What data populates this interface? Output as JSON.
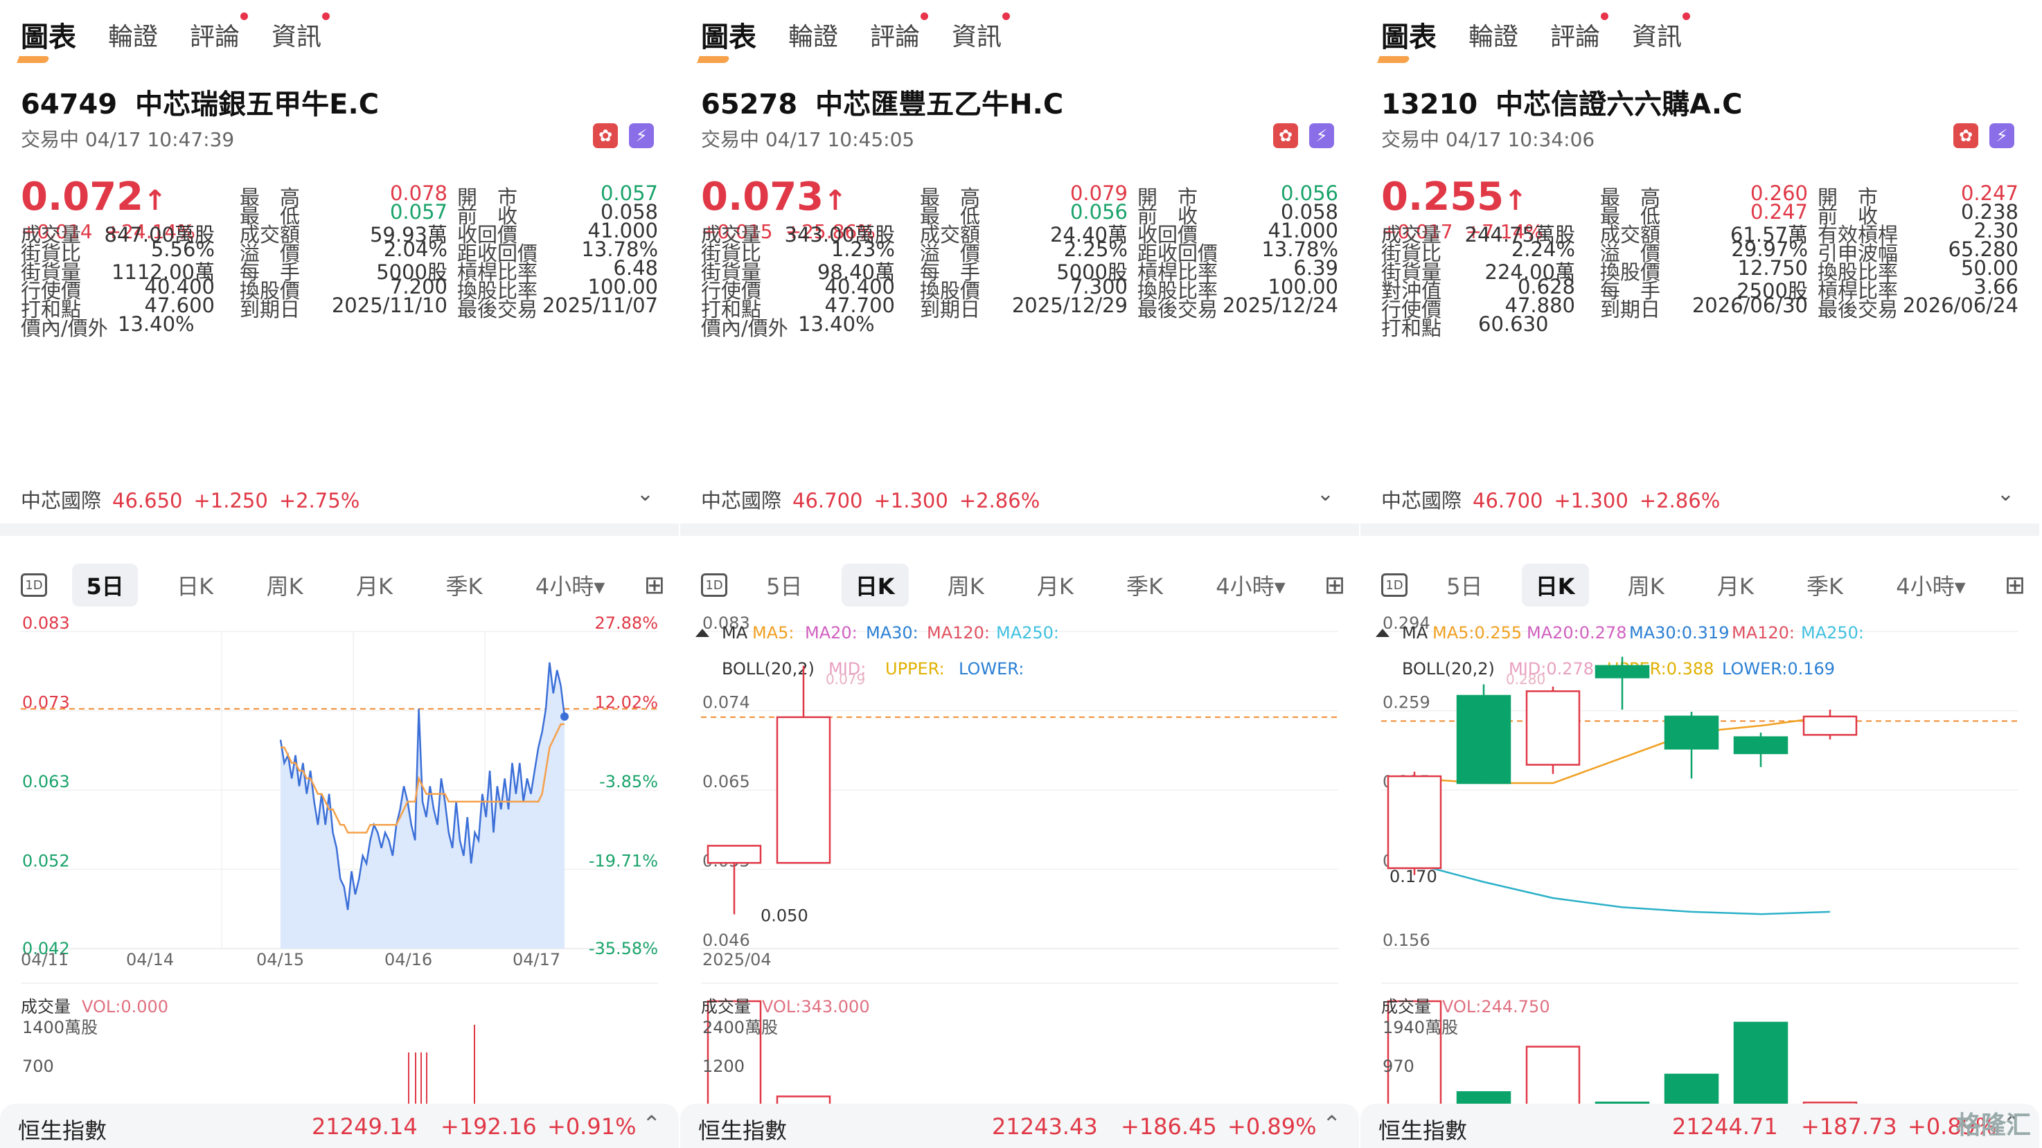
{
  "tabs": [
    {
      "label": "圖表",
      "active": true,
      "dot": false
    },
    {
      "label": "輪證",
      "active": false,
      "dot": false
    },
    {
      "label": "評論",
      "active": false,
      "dot": true
    },
    {
      "label": "資訊",
      "active": false,
      "dot": true
    }
  ],
  "panels": [
    {
      "code": "64749",
      "name": "中芯瑞銀五甲牛E.C",
      "status": "交易中 04/17 10:47:39",
      "price": "0.072",
      "change": "+0.014",
      "change_pct": "+24.14%",
      "quotes": [
        [
          [
            "最　高",
            "0.078",
            "red"
          ],
          [
            "開　市",
            "0.057",
            "green"
          ]
        ],
        [
          [
            "最　低",
            "0.057",
            "green"
          ],
          [
            "前　收",
            "0.058",
            ""
          ]
        ],
        [
          [
            "成交量",
            "847.00萬股",
            ""
          ],
          [
            "成交額",
            "59.93萬",
            ""
          ],
          [
            "收回價",
            "41.000",
            ""
          ]
        ],
        [
          [
            "街貨比",
            "5.56%",
            ""
          ],
          [
            "溢　價",
            "2.04%",
            ""
          ],
          [
            "距收回價",
            "13.78%",
            ""
          ]
        ],
        [
          [
            "街貨量",
            "1112.00萬",
            ""
          ],
          [
            "每　手",
            "5000股",
            ""
          ],
          [
            "槓桿比率",
            "6.48",
            ""
          ]
        ],
        [
          [
            "行使價",
            "40.400",
            ""
          ],
          [
            "換股價",
            "7.200",
            ""
          ],
          [
            "換股比率",
            "100.00",
            ""
          ]
        ],
        [
          [
            "打和點",
            "47.600",
            ""
          ],
          [
            "到期日",
            "2025/11/10",
            ""
          ],
          [
            "最後交易",
            "2025/11/07",
            ""
          ]
        ],
        [
          [
            "價內/價外",
            "13.40%",
            ""
          ]
        ]
      ],
      "underlying": {
        "name": "中芯國際",
        "price": "46.650",
        "change": "+1.250",
        "pct": "+2.75%"
      },
      "ktabs": [
        "5日",
        "日K",
        "周K",
        "月K",
        "季K",
        "4小時▾"
      ],
      "ktab_active": 0,
      "index": {
        "name": "恒生指數",
        "value": "21249.14",
        "change": "+192.16",
        "pct": "+0.91%"
      }
    },
    {
      "code": "65278",
      "name": "中芯匯豐五乙牛H.C",
      "status": "交易中 04/17 10:45:05",
      "price": "0.073",
      "change": "+0.015",
      "change_pct": "+25.86%",
      "quotes": [
        [
          [
            "最　高",
            "0.079",
            "red"
          ],
          [
            "開　市",
            "0.056",
            "green"
          ]
        ],
        [
          [
            "最　低",
            "0.056",
            "green"
          ],
          [
            "前　收",
            "0.058",
            ""
          ]
        ],
        [
          [
            "成交量",
            "343.00萬股",
            ""
          ],
          [
            "成交額",
            "24.40萬",
            ""
          ],
          [
            "收回價",
            "41.000",
            ""
          ]
        ],
        [
          [
            "街貨比",
            "1.23%",
            ""
          ],
          [
            "溢　價",
            "2.25%",
            ""
          ],
          [
            "距收回價",
            "13.78%",
            ""
          ]
        ],
        [
          [
            "街貨量",
            "98.40萬",
            ""
          ],
          [
            "每　手",
            "5000股",
            ""
          ],
          [
            "槓桿比率",
            "6.39",
            ""
          ]
        ],
        [
          [
            "行使價",
            "40.400",
            ""
          ],
          [
            "換股價",
            "7.300",
            ""
          ],
          [
            "換股比率",
            "100.00",
            ""
          ]
        ],
        [
          [
            "打和點",
            "47.700",
            ""
          ],
          [
            "到期日",
            "2025/12/29",
            ""
          ],
          [
            "最後交易",
            "2025/12/24",
            ""
          ]
        ],
        [
          [
            "價內/價外",
            "13.40%",
            ""
          ]
        ]
      ],
      "underlying": {
        "name": "中芯國際",
        "price": "46.700",
        "change": "+1.300",
        "pct": "+2.86%"
      },
      "ktabs": [
        "5日",
        "日K",
        "周K",
        "月K",
        "季K",
        "4小時▾"
      ],
      "ktab_active": 1,
      "index": {
        "name": "恒生指數",
        "value": "21243.43",
        "change": "+186.45",
        "pct": "+0.89%"
      }
    },
    {
      "code": "13210",
      "name": "中芯信證六六購A.C",
      "status": "交易中 04/17 10:34:06",
      "price": "0.255",
      "change": "+0.017",
      "change_pct": "+7.14%",
      "quotes": [
        [
          [
            "最　高",
            "0.260",
            "red"
          ],
          [
            "開　市",
            "0.247",
            "red"
          ]
        ],
        [
          [
            "最　低",
            "0.247",
            "red"
          ],
          [
            "前　收",
            "0.238",
            ""
          ]
        ],
        [
          [
            "成交量",
            "244.75萬股",
            ""
          ],
          [
            "成交額",
            "61.57萬",
            ""
          ],
          [
            "有效槓桿",
            "2.30",
            ""
          ]
        ],
        [
          [
            "街貨比",
            "2.24%",
            ""
          ],
          [
            "溢　價",
            "29.97%",
            ""
          ],
          [
            "引申波幅",
            "65.280",
            ""
          ]
        ],
        [
          [
            "街貨量",
            "224.00萬",
            ""
          ],
          [
            "換股價",
            "12.750",
            ""
          ],
          [
            "換股比率",
            "50.00",
            ""
          ]
        ],
        [
          [
            "對沖值",
            "0.628",
            ""
          ],
          [
            "每　手",
            "2500股",
            ""
          ],
          [
            "槓桿比率",
            "3.66",
            ""
          ]
        ],
        [
          [
            "行使價",
            "47.880",
            ""
          ],
          [
            "到期日",
            "2026/06/30",
            ""
          ],
          [
            "最後交易",
            "2026/06/24",
            ""
          ]
        ],
        [
          [
            "打和點",
            "60.630",
            ""
          ]
        ]
      ],
      "underlying": {
        "name": "中芯國際",
        "price": "46.700",
        "change": "+1.300",
        "pct": "+2.86%"
      },
      "ktabs": [
        "5日",
        "日K",
        "周K",
        "月K",
        "季K",
        "4小時▾"
      ],
      "ktab_active": 1,
      "index": {
        "name": "恒生指數",
        "value": "21244.71",
        "change": "+187.73",
        "pct": "+0.89%"
      }
    }
  ],
  "chart_data": [
    {
      "type": "line",
      "yticks": [
        "0.083",
        "0.073",
        "0.063",
        "0.052",
        "0.042"
      ],
      "pct_ticks": [
        "27.88%",
        "12.02%",
        "-3.85%",
        "-19.71%",
        "-35.58%"
      ],
      "xticks": [
        "04/11",
        "04/14",
        "04/15",
        "04/16",
        "04/17"
      ],
      "prev_close": 0.073,
      "ylim": [
        0.042,
        0.083
      ],
      "series": [
        {
          "values": [
            0.0,
            0.069,
            0.066,
            0.067,
            0.064,
            0.067,
            0.063,
            0.066,
            0.062,
            0.065,
            0.061,
            0.058,
            0.062,
            0.058,
            0.062,
            0.057,
            0.055,
            0.051,
            0.05,
            0.047,
            0.052,
            0.049,
            0.051,
            0.054,
            0.053,
            0.056,
            0.058,
            0.057,
            0.055,
            0.057,
            0.056,
            0.054,
            0.058,
            0.06,
            0.063,
            0.061,
            0.058,
            0.056,
            0.073,
            0.061,
            0.059,
            0.063,
            0.06,
            0.058,
            0.064,
            0.061,
            0.057,
            0.055,
            0.061,
            0.056,
            0.054,
            0.059,
            0.053,
            0.057,
            0.056,
            0.062,
            0.059,
            0.065,
            0.057,
            0.063,
            0.06,
            0.064,
            0.06,
            0.066,
            0.062,
            0.066,
            0.061,
            0.064,
            0.062,
            0.065,
            0.068,
            0.07,
            0.073,
            0.079,
            0.075,
            0.078,
            0.076,
            0.072
          ]
        },
        {
          "values": [
            0.0,
            0.068,
            0.068,
            0.067,
            0.066,
            0.066,
            0.065,
            0.065,
            0.064,
            0.064,
            0.063,
            0.062,
            0.062,
            0.061,
            0.06,
            0.06,
            0.059,
            0.058,
            0.058,
            0.057,
            0.057,
            0.057,
            0.057,
            0.057,
            0.057,
            0.058,
            0.058,
            0.058,
            0.058,
            0.058,
            0.058,
            0.058,
            0.058,
            0.059,
            0.06,
            0.061,
            0.061,
            0.061,
            0.064,
            0.063,
            0.062,
            0.062,
            0.062,
            0.062,
            0.062,
            0.062,
            0.061,
            0.061,
            0.061,
            0.061,
            0.061,
            0.061,
            0.061,
            0.061,
            0.061,
            0.061,
            0.061,
            0.061,
            0.061,
            0.061,
            0.061,
            0.061,
            0.061,
            0.061,
            0.061,
            0.061,
            0.061,
            0.061,
            0.061,
            0.061,
            0.061,
            0.062,
            0.065,
            0.068,
            0.069,
            0.07,
            0.071,
            0.071
          ]
        }
      ],
      "volume_label": "成交量",
      "volume_value": "VOL:0.000",
      "vol_ticks": [
        "1400萬股",
        "700"
      ]
    },
    {
      "type": "candlestick",
      "yticks": [
        "0.083",
        "0.074",
        "0.065",
        "0.055",
        "0.046"
      ],
      "xticks": [
        "2025/04"
      ],
      "ylim": [
        0.046,
        0.083
      ],
      "last": 0.073,
      "ma_label": "MA",
      "ma": [
        "MA5:",
        "MA20:",
        "MA30:",
        "MA120:",
        "MA250:"
      ],
      "boll": [
        "BOLL(20,2)",
        "MID:",
        "UPPER:",
        "LOWER:"
      ],
      "boll_mid_value": "0.079",
      "candles": [
        {
          "open": 0.056,
          "close": 0.058,
          "high": 0.058,
          "low": 0.05
        },
        {
          "open": 0.056,
          "close": 0.073,
          "high": 0.079,
          "low": 0.056
        }
      ],
      "low_label": "0.050",
      "volume_label": "成交量",
      "volume_value": "VOL:343.000",
      "vol_ticks": [
        "2400萬股",
        "1200"
      ],
      "volumes": [
        2400,
        200
      ]
    },
    {
      "type": "candlestick",
      "yticks": [
        "0.294",
        "0.259",
        "0.225",
        "0.191",
        "0.156"
      ],
      "ylim": [
        0.156,
        0.294
      ],
      "last": 0.255,
      "ma_label": "MA",
      "ma": [
        "MA5:0.255",
        "MA20:0.278",
        "MA30:0.319",
        "MA120:",
        "MA250:"
      ],
      "boll": [
        "BOLL(20,2)",
        "MID:0.278",
        "UPPER:0.388",
        "LOWER:0.169"
      ],
      "boll_mid_value": "0.280",
      "candles": [
        {
          "open": 0.191,
          "close": 0.231,
          "high": 0.233,
          "low": 0.188
        },
        {
          "open": 0.266,
          "close": 0.228,
          "high": 0.271,
          "low": 0.228
        },
        {
          "open": 0.236,
          "close": 0.268,
          "high": 0.27,
          "low": 0.232
        },
        {
          "open": 0.279,
          "close": 0.274,
          "high": 0.283,
          "low": 0.26
        },
        {
          "open": 0.257,
          "close": 0.243,
          "high": 0.259,
          "low": 0.23
        },
        {
          "open": 0.248,
          "close": 0.241,
          "high": 0.25,
          "low": 0.235
        },
        {
          "open": 0.249,
          "close": 0.257,
          "high": 0.26,
          "low": 0.247
        }
      ],
      "ma5": [
        0.23,
        0.228,
        0.228,
        0.239,
        0.25,
        0.253,
        0.257
      ],
      "lower": [
        0.193,
        0.185,
        0.178,
        0.174,
        0.172,
        0.171,
        0.172
      ],
      "low_label": "0.170",
      "volume_label": "成交量",
      "volume_value": "VOL:244.750",
      "vol_ticks": [
        "1940萬股",
        "970"
      ],
      "volumes": [
        1600,
        200,
        900,
        40,
        470,
        1270,
        40
      ]
    }
  ],
  "watermark": "格隆汇"
}
